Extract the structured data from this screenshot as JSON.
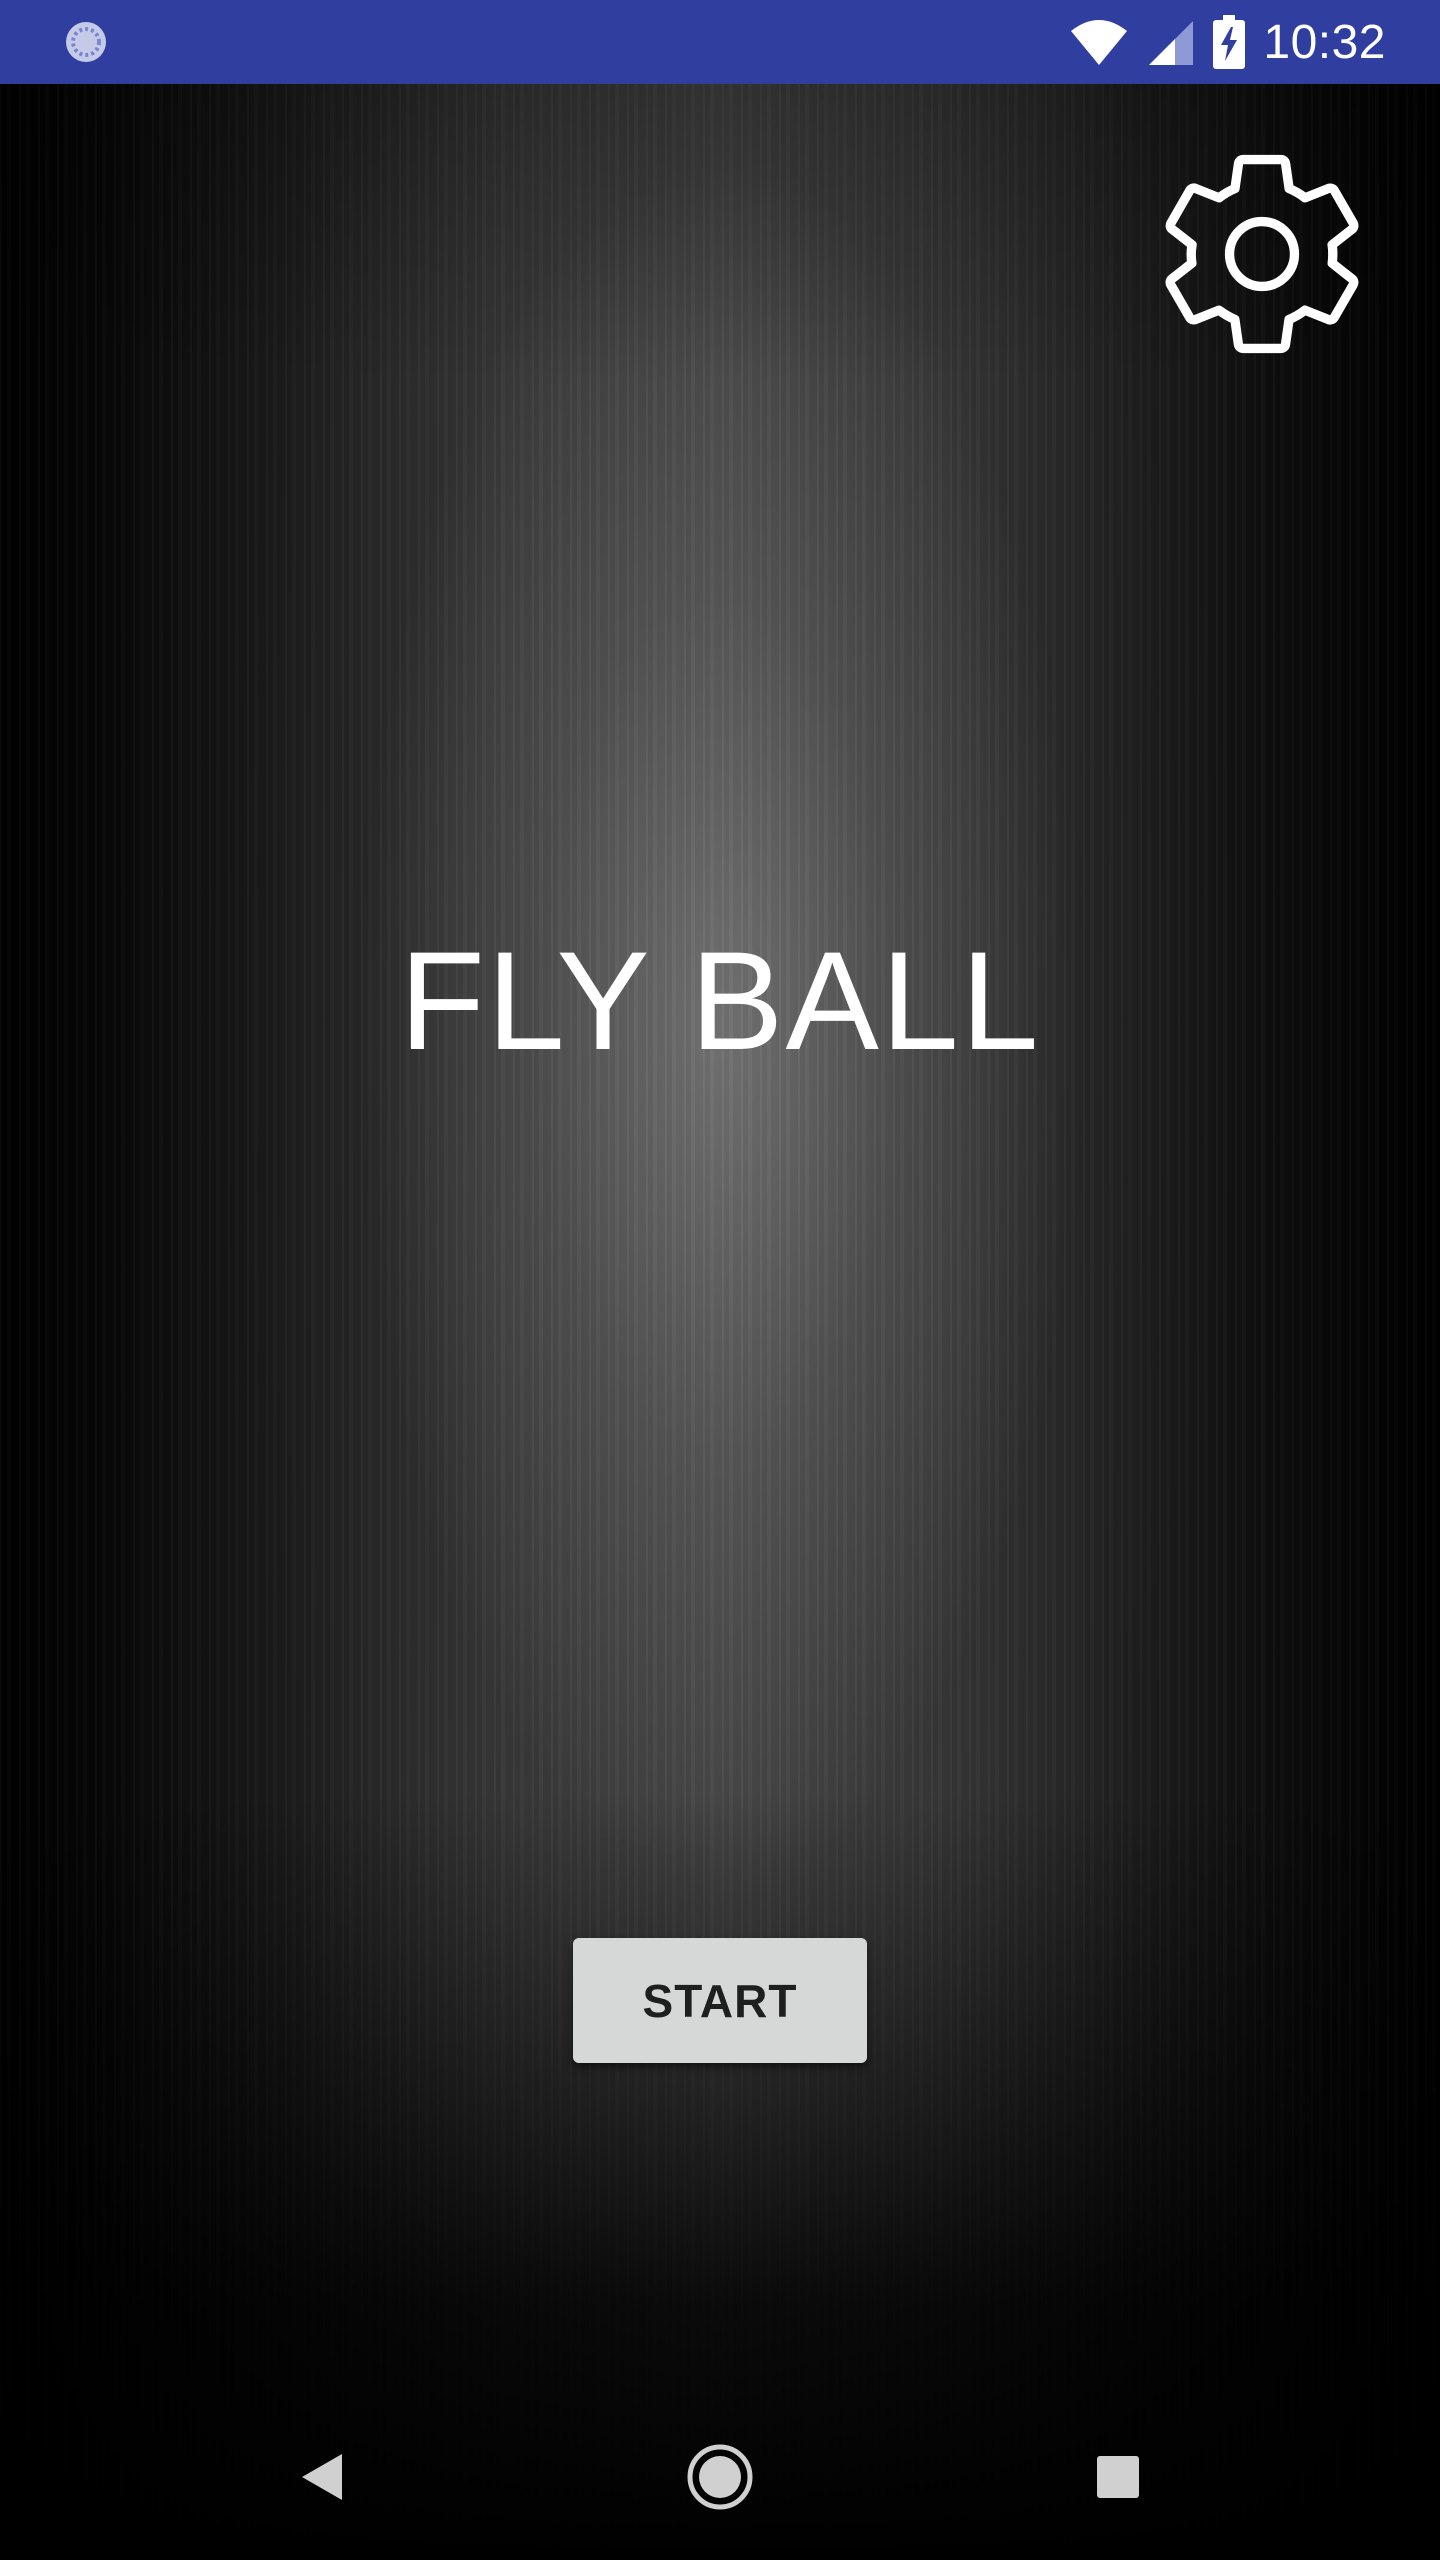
{
  "status_bar": {
    "time": "10:32",
    "background_color": "#303f9f",
    "left_icon": "loading-spinner-icon",
    "right_icons": [
      "wifi-icon",
      "cell-signal-icon",
      "battery-charging-icon"
    ]
  },
  "settings": {
    "icon": "gear-icon"
  },
  "title": "FLY BALL",
  "start_button": {
    "label": "START"
  },
  "nav_bar": {
    "icons": [
      "back-icon",
      "home-icon",
      "recent-apps-icon"
    ]
  }
}
